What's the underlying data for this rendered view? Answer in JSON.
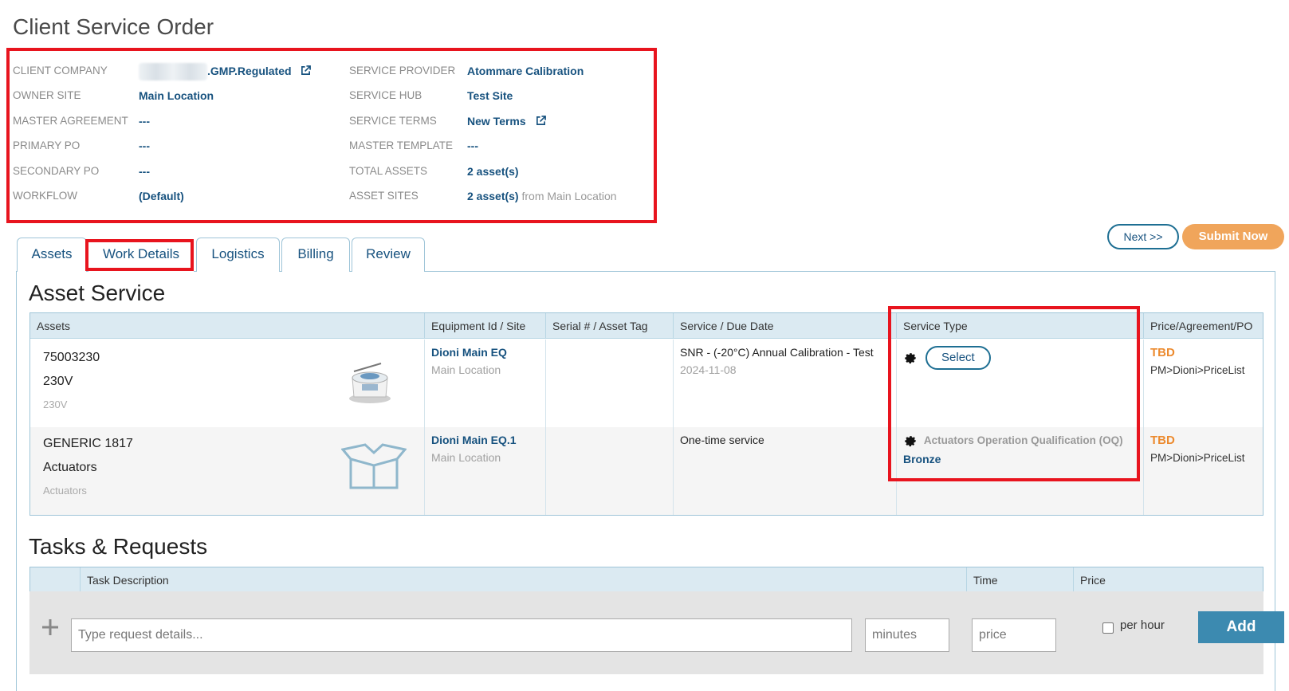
{
  "page": {
    "title": "Client Service Order"
  },
  "summary": {
    "left": [
      {
        "label": "CLIENT COMPANY",
        "value": ".GMP.Regulated"
      },
      {
        "label": "OWNER SITE",
        "value": "Main Location"
      },
      {
        "label": "MASTER AGREEMENT",
        "value": "---"
      },
      {
        "label": "PRIMARY PO",
        "value": "---"
      },
      {
        "label": "SECONDARY PO",
        "value": "---"
      },
      {
        "label": "WORKFLOW",
        "value": "(Default)"
      }
    ],
    "right": [
      {
        "label": "SERVICE PROVIDER",
        "value": "Atommare Calibration"
      },
      {
        "label": "SERVICE HUB",
        "value": "Test Site"
      },
      {
        "label": "SERVICE TERMS",
        "value": "New Terms"
      },
      {
        "label": "MASTER TEMPLATE",
        "value": "---"
      },
      {
        "label": "TOTAL ASSETS",
        "value": "2 asset(s)"
      },
      {
        "label": "ASSET SITES",
        "value": "2 asset(s)",
        "suffix": "from Main Location"
      }
    ]
  },
  "actions": {
    "next": "Next >>",
    "submit": "Submit Now"
  },
  "tabs": [
    "Assets",
    "Work Details",
    "Logistics",
    "Billing",
    "Review"
  ],
  "asset_service": {
    "title": "Asset Service",
    "columns": [
      "Assets",
      "Equipment Id / Site",
      "Serial # / Asset Tag",
      "Service / Due Date",
      "Service Type",
      "Price/Agreement/PO"
    ],
    "rows": [
      {
        "asset_name": "75003230",
        "asset_model": "230V",
        "asset_sub": "230V",
        "equipment": "Dioni Main EQ",
        "site": "Main Location",
        "serial": "",
        "service": "SNR - (-20°C) Annual Calibration - Test",
        "due": "2024-11-08",
        "select_label": "Select",
        "price": "TBD",
        "pricelist": "PM>Dioni>PriceList"
      },
      {
        "asset_name": "GENERIC 1817",
        "asset_model": "Actuators",
        "asset_sub": "Actuators",
        "equipment": "Dioni Main EQ.1",
        "site": "Main Location",
        "serial": "",
        "service": "One-time service",
        "service_type": "Actuators Operation Qualification (OQ)",
        "service_level": "Bronze",
        "price": "TBD",
        "pricelist": "PM>Dioni>PriceList"
      }
    ]
  },
  "tasks": {
    "title": "Tasks & Requests",
    "columns": [
      "Task Description",
      "Time",
      "Price"
    ],
    "input_placeholder": "Type request details...",
    "minutes_placeholder": "minutes",
    "price_placeholder": "price",
    "per_hour_label": "per hour",
    "add_label": "Add"
  },
  "colors": {
    "link": "#17527f",
    "accent": "#f0a55b",
    "tbd": "#ec8a2e",
    "highlight": "#e8141e",
    "header_bg": "#dbeaf2"
  }
}
